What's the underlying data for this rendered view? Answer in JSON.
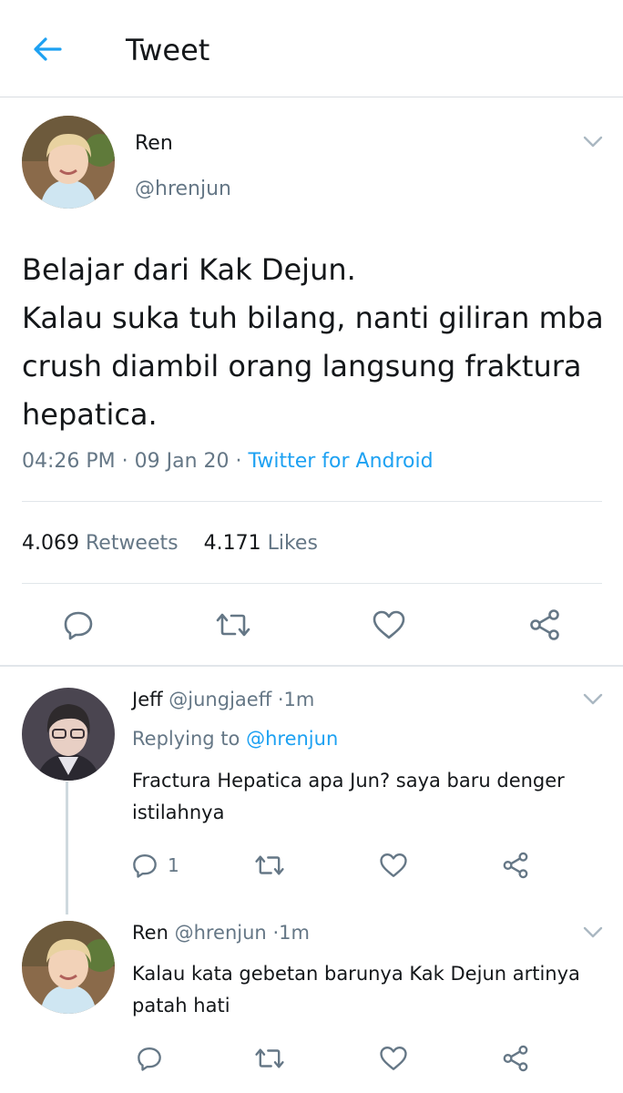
{
  "header": {
    "title": "Tweet",
    "back_icon": "back-arrow-icon",
    "accent": "#1da1f2"
  },
  "main_tweet": {
    "name": "Ren",
    "handle": "@hrenjun",
    "text_lines": [
      "Belajar dari Kak Dejun.",
      "Kalau suka tuh bilang, nanti giliran mba",
      "crush diambil orang langsung fraktura",
      "hepatica."
    ],
    "time": "04:26 PM",
    "date": "09 Jan 20",
    "source": "Twitter for Android",
    "retweets_count": "4.069",
    "retweets_label": "Retweets",
    "likes_count": "4.171",
    "likes_label": "Likes"
  },
  "replies": [
    {
      "name": "Jeff",
      "handle": "@jungjaeff",
      "time": "1m",
      "replying_label": "Replying to",
      "replying_to": "@hrenjun",
      "text_lines": [
        "Fractura Hepatica apa Jun? saya baru denger",
        "istilahnya"
      ],
      "reply_count": "1"
    },
    {
      "name": "Ren",
      "handle": "@hrenjun",
      "time": "1m",
      "text_lines": [
        "Kalau kata gebetan barunya Kak Dejun artinya",
        "patah hati"
      ]
    }
  ],
  "separator": "·",
  "colors": {
    "text": "#14171a",
    "secondary": "#657786",
    "link": "#1da1f2",
    "border": "#e1e6ea"
  }
}
